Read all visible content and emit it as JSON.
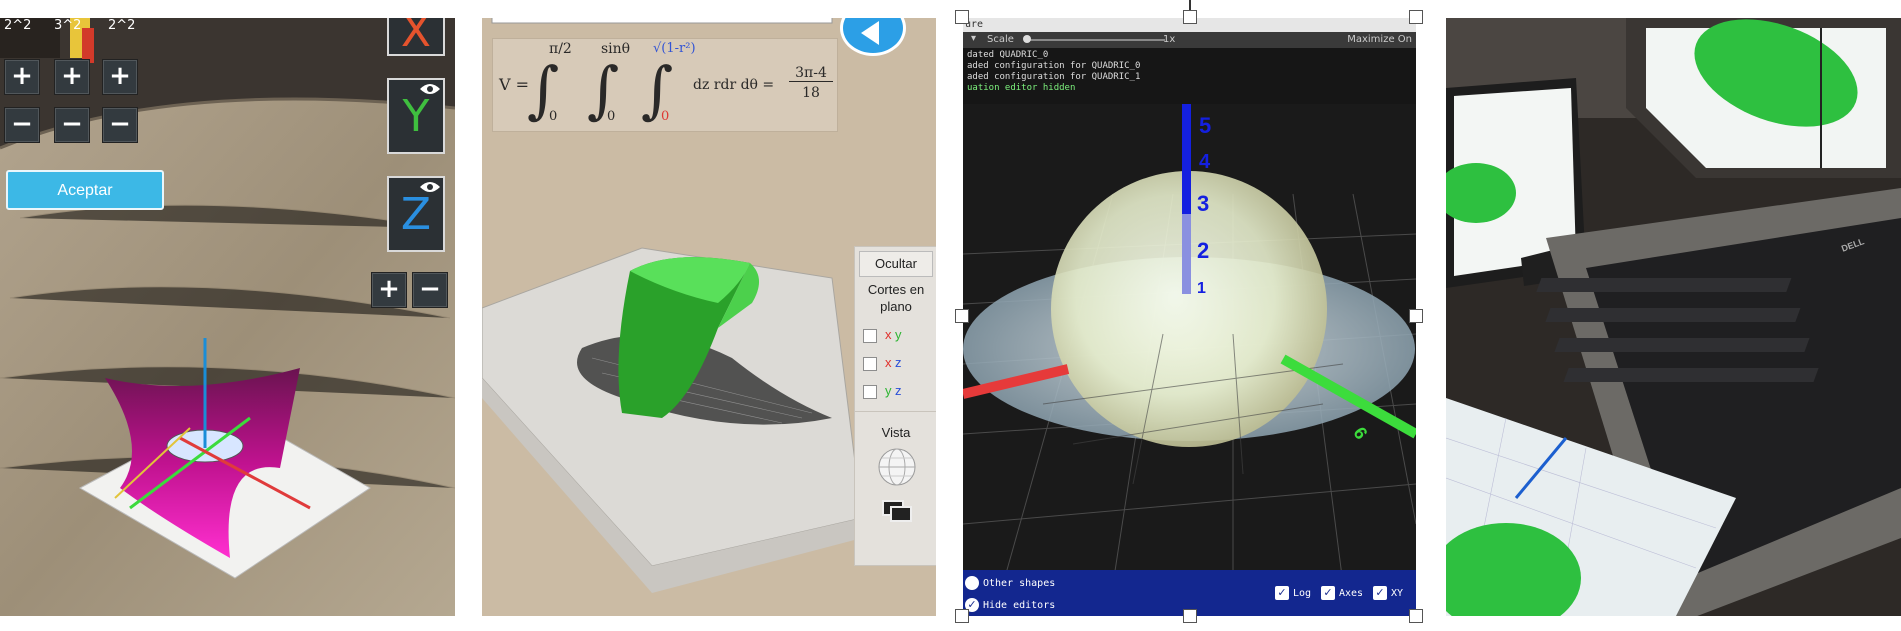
{
  "panel1": {
    "top_labels": [
      "2^2",
      "3^2",
      "2^2"
    ],
    "plus_symbol": "+",
    "minus_symbol": "−",
    "accept_button": "Aceptar",
    "axis_x": "X",
    "axis_y": "Y",
    "axis_z": "Z",
    "zoom_in": "+",
    "zoom_out": "−",
    "icons": [
      "eye-icon"
    ]
  },
  "panel2": {
    "formula": {
      "prefix": "V =",
      "upper1": "π/2",
      "lower1": "0",
      "upper2": "sinθ",
      "lower2": "0",
      "upper3": "√(1-r²)",
      "lower3": "0",
      "integrand": "dz rdr dθ =",
      "numerator": "3π-4",
      "denominator": "18"
    },
    "hide_button": "Ocultar",
    "cuts_title": "Cortes en plano",
    "plane_options": [
      {
        "a": "x",
        "b": "y"
      },
      {
        "a": "x",
        "b": "z"
      },
      {
        "a": "y",
        "b": "z"
      }
    ],
    "view_title": "Vista",
    "icons": [
      "sphere-view-icon",
      "windows-icon",
      "back-arrow-icon"
    ],
    "colors": {
      "x": "#e0312d",
      "y": "#2fb534",
      "z": "#2a4fd8"
    }
  },
  "panel3": {
    "window_title": "ure",
    "scale_label": "Scale",
    "scale_value": "1x",
    "maximize_label": "Maximize On",
    "console_lines": [
      "dated QUADRIC_0",
      "aded configuration for QUADRIC_0",
      "aded configuration for QUADRIC_1",
      "uation editor hidden"
    ],
    "axis_ticks": [
      "5",
      "4",
      "3",
      "2",
      "1"
    ],
    "axis_marks": [
      "6"
    ],
    "footer": {
      "other_shapes": "Other shapes",
      "hide_editors": "Hide editors",
      "log": "Log",
      "axes": "Axes",
      "xy": "XY"
    }
  },
  "panel4": {
    "brand": "DELL"
  }
}
